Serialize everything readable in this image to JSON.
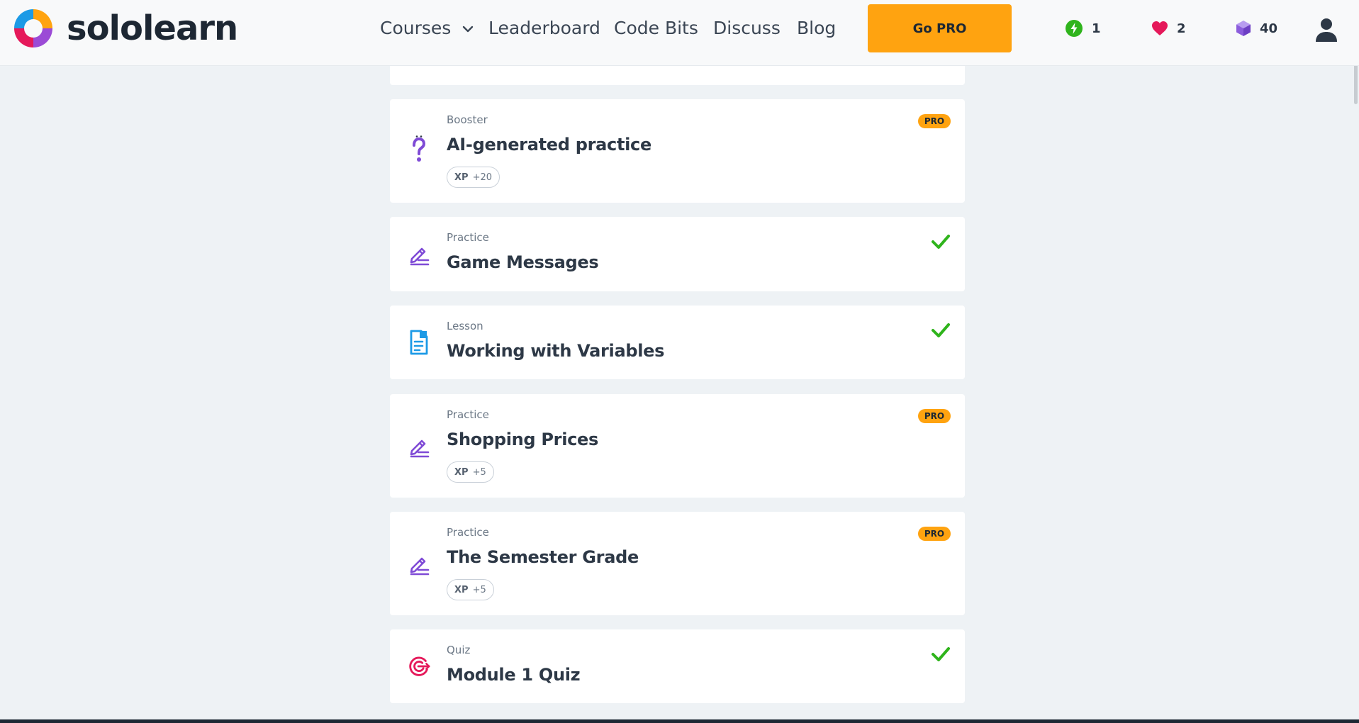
{
  "brand": {
    "name": "sololearn"
  },
  "nav": {
    "courses": "Courses",
    "leaderboard": "Leaderboard",
    "codebits": "Code Bits",
    "discuss": "Discuss",
    "blog": "Blog"
  },
  "gopro": {
    "label": "Go PRO"
  },
  "stats": {
    "streak": "1",
    "hearts": "2",
    "gems": "40"
  },
  "colors": {
    "accent": "#ffa310",
    "check": "#2fb41c",
    "practice_icon": "#7f4bd6",
    "lesson_icon": "#1c9ae6",
    "quiz_icon": "#e5195a"
  },
  "cards": [
    {
      "type": "Booster",
      "title": "AI-generated practice",
      "xp_label": "XP",
      "xp_value": "+20",
      "badge": "PRO",
      "icon": "question-icon"
    },
    {
      "type": "Practice",
      "title": "Game Messages",
      "icon": "pencil-icon",
      "status": "completed"
    },
    {
      "type": "Lesson",
      "title": "Working with Variables",
      "icon": "document-icon",
      "status": "completed"
    },
    {
      "type": "Practice",
      "title": "Shopping Prices",
      "xp_label": "XP",
      "xp_value": "+5",
      "badge": "PRO",
      "icon": "pencil-icon"
    },
    {
      "type": "Practice",
      "title": "The Semester Grade",
      "xp_label": "XP",
      "xp_value": "+5",
      "badge": "PRO",
      "icon": "pencil-icon"
    },
    {
      "type": "Quiz",
      "title": "Module 1 Quiz",
      "icon": "target-icon",
      "status": "completed"
    }
  ]
}
